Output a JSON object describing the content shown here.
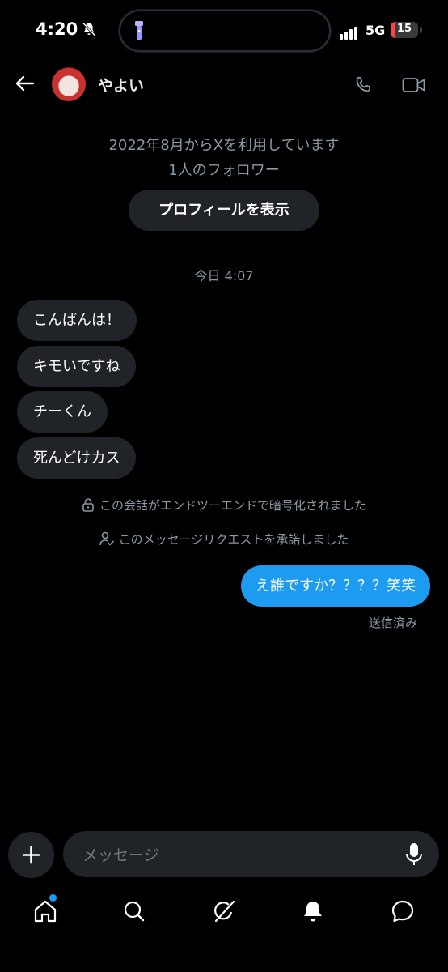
{
  "status_bar": {
    "time": "4:20",
    "network": "5G",
    "battery": "15",
    "battery_level": 0.15,
    "battery_color": "#ff453a"
  },
  "header": {
    "name": "やよい"
  },
  "intro": {
    "joined": "2022年8月からXを利用しています",
    "followers": "1人のフォロワー",
    "profile_button": "プロフィールを表示"
  },
  "conversation": {
    "date": "今日 4:07",
    "incoming": [
      {
        "text": "こんばんは！"
      },
      {
        "text": "キモいですね"
      },
      {
        "text": "チーくん"
      },
      {
        "text": "死んどけカス"
      }
    ],
    "system_notes": [
      {
        "icon": "lock-icon",
        "text": "この会話がエンドツーエンドで暗号化されました"
      },
      {
        "icon": "person-check-icon",
        "text": "このメッセージリクエストを承諾しました"
      }
    ],
    "outgoing": {
      "text": "え誰ですか？？？？笑笑",
      "status": "送信済み"
    }
  },
  "composer": {
    "placeholder": "メッセージ"
  },
  "tab_bar": {
    "icons": [
      "home-icon",
      "search-icon",
      "grok-icon",
      "notifications-icon",
      "messages-icon"
    ]
  },
  "colors": {
    "accent": "#1d9bf0",
    "bubble": "#202327",
    "muted": "#8b98a5",
    "background": "#000000"
  }
}
